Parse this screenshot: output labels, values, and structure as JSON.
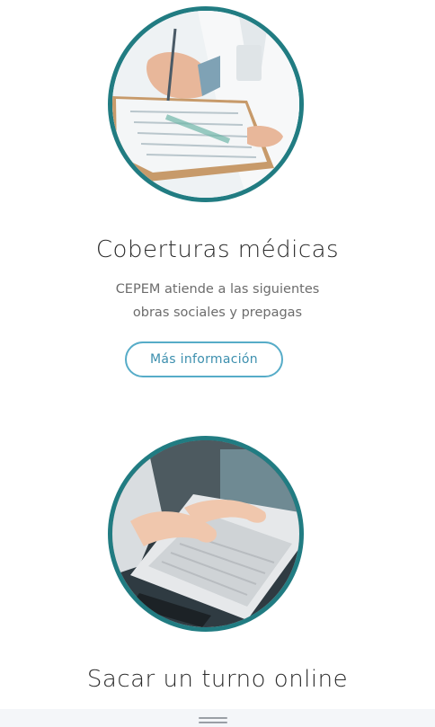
{
  "cards": [
    {
      "title": "Coberturas médicas",
      "description_lines": [
        "CEPEM atiende a las siguientes",
        "obras sociales y prepagas"
      ],
      "button_label": "Más información",
      "image": "doctor-writing-on-clipboard"
    },
    {
      "title": "Sacar un turno online",
      "image": "hands-typing-on-laptop"
    }
  ],
  "colors": {
    "ring": "#217c82",
    "button_border": "#56acc8",
    "button_text": "#3c8fae",
    "title": "#2b2b2b",
    "text": "#6c6c6c"
  },
  "footer": {
    "icon": "menu-handle-icon"
  }
}
